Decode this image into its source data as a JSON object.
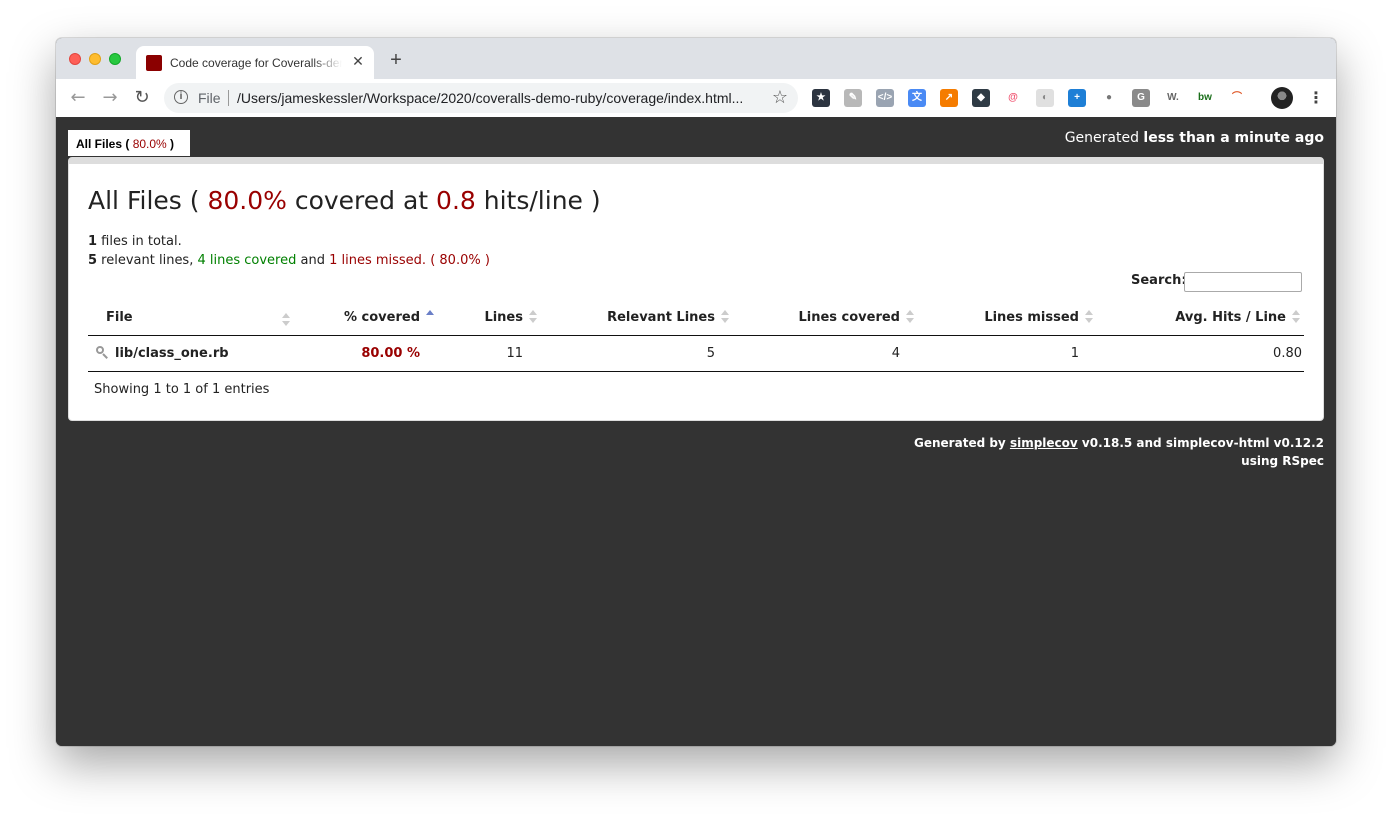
{
  "browser": {
    "tab_title": "Code coverage for Coveralls-demo-ruby",
    "tab_close_glyph": "✕",
    "new_tab_glyph": "+",
    "url_scheme_label": "File",
    "url": "/Users/jameskessler/Workspace/2020/coveralls-demo-ruby/coverage/index.html...",
    "nav": {
      "back": "←",
      "forward": "→",
      "reload": "↻"
    },
    "star_glyph": "☆",
    "menu_glyph": "⋮",
    "extensions": [
      {
        "name": "bookmark-star-extension-icon",
        "glyph": "★",
        "color": "#3b4252"
      },
      {
        "name": "puzzle-extension-icon",
        "glyph": "✎",
        "color": "#b5b5b5"
      },
      {
        "name": "code-extension-icon",
        "glyph": "</>",
        "color": "#9aa4b2"
      },
      {
        "name": "translate-extension-icon",
        "glyph": "文",
        "color": "#4a8af4"
      },
      {
        "name": "analytics-extension-icon",
        "glyph": "↗",
        "color": "#f57c00"
      },
      {
        "name": "shield-extension-icon",
        "glyph": "◆",
        "color": "#2f3b45"
      },
      {
        "name": "spiral-extension-icon",
        "glyph": "@",
        "color": "#f0506e"
      },
      {
        "name": "disc-extension-icon",
        "glyph": "◐",
        "color": "#bdbdbd"
      },
      {
        "name": "plus-extension-icon",
        "glyph": "+",
        "color": "#1e7fd6"
      },
      {
        "name": "circle-extension-icon",
        "glyph": "●",
        "color": "#7a7a7a"
      },
      {
        "name": "g-extension-icon",
        "glyph": "G",
        "color": "#8a8a8a"
      },
      {
        "name": "w-extension-icon",
        "glyph": "W.",
        "color": "#ffffff"
      },
      {
        "name": "bw-extension-icon",
        "glyph": "bw",
        "color": "#ffffff"
      },
      {
        "name": "rainbow-extension-icon",
        "glyph": "⌒",
        "color": "#ffffff"
      }
    ]
  },
  "coverage_tab": {
    "label_prefix": "All Files ( ",
    "percent": "80.0%",
    "label_suffix": " )"
  },
  "generated_ago": {
    "prefix": "Generated ",
    "time": "less than a minute ago"
  },
  "heading": {
    "prefix": "All Files ( ",
    "percent": "80.0%",
    "middle": " covered at ",
    "hits": "0.8",
    "suffix": " hits/line )"
  },
  "summary": {
    "files_count": "1",
    "files_text": " files in total.",
    "relevant_count": "5",
    "relevant_text": " relevant lines, ",
    "covered_text": "4 lines covered",
    "and_text": " and ",
    "missed_text": "1 lines missed.",
    "percent_text": " ( 80.0% )"
  },
  "search": {
    "label": "Search:",
    "value": ""
  },
  "table": {
    "headers": [
      "File",
      "% covered",
      "Lines",
      "Relevant Lines",
      "Lines covered",
      "Lines missed",
      "Avg. Hits / Line"
    ],
    "rows": [
      {
        "file": "lib/class_one.rb",
        "covered": "80.00 %",
        "lines": "11",
        "relevant": "5",
        "covered_lines": "4",
        "missed": "1",
        "avg_hits": "0.80"
      }
    ]
  },
  "showing_text": "Showing 1 to 1 of 1 entries",
  "footer": {
    "prefix": "Generated by ",
    "link": "simplecov",
    "suffix": " v0.18.5 and simplecov-html v0.12.2",
    "line2": "using RSpec"
  },
  "colors": {
    "accent_red": "#990000",
    "covered_green": "#008000",
    "background": "#333333"
  }
}
